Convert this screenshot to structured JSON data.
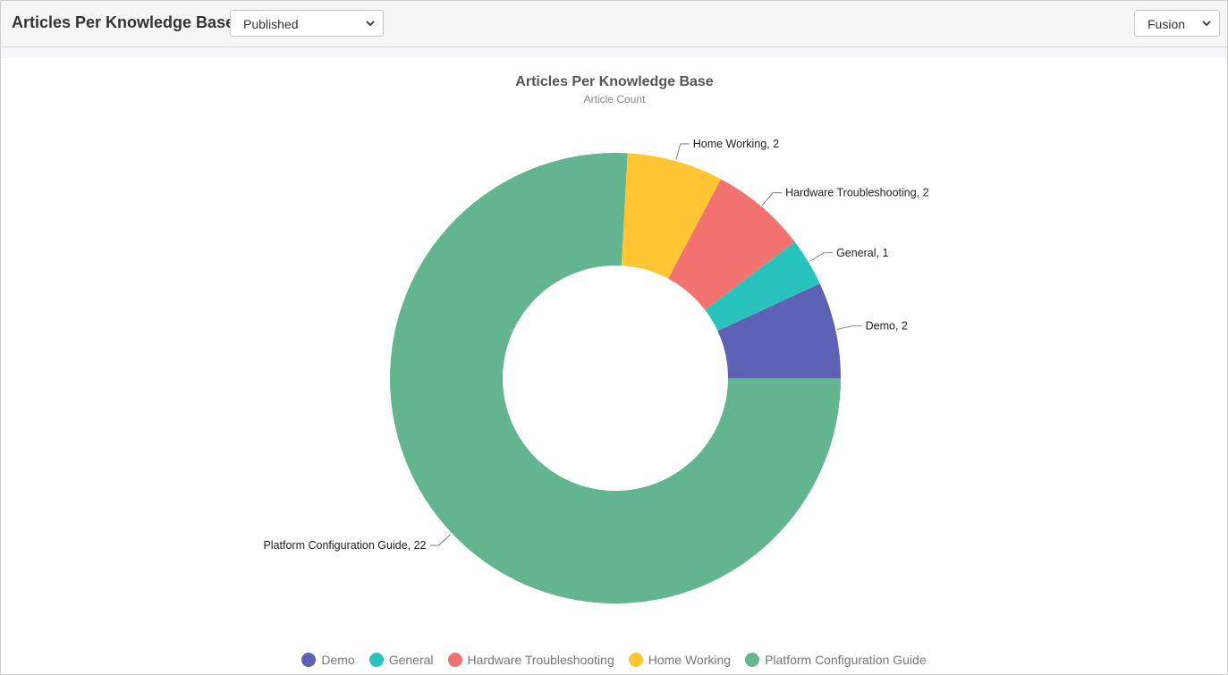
{
  "header": {
    "title": "Articles Per Knowledge Base",
    "status_select": {
      "value": "Published"
    },
    "engine_select": {
      "value": "Fusion"
    }
  },
  "chart_data": {
    "type": "pie",
    "donut": true,
    "title": "Articles Per Knowledge Base",
    "subtitle": "Article Count",
    "categories": [
      "Demo",
      "General",
      "Hardware Troubleshooting",
      "Home Working",
      "Platform Configuration Guide"
    ],
    "values": [
      2,
      1,
      2,
      2,
      22
    ],
    "colors": [
      "#5d62b5",
      "#29c3be",
      "#f2726f",
      "#ffc533",
      "#62b58f"
    ],
    "data_labels": [
      "Demo, 2",
      "General, 1",
      "Hardware Troubleshooting, 2",
      "Home Working, 2",
      "Platform Configuration Guide, 22"
    ],
    "legend_position": "bottom"
  }
}
